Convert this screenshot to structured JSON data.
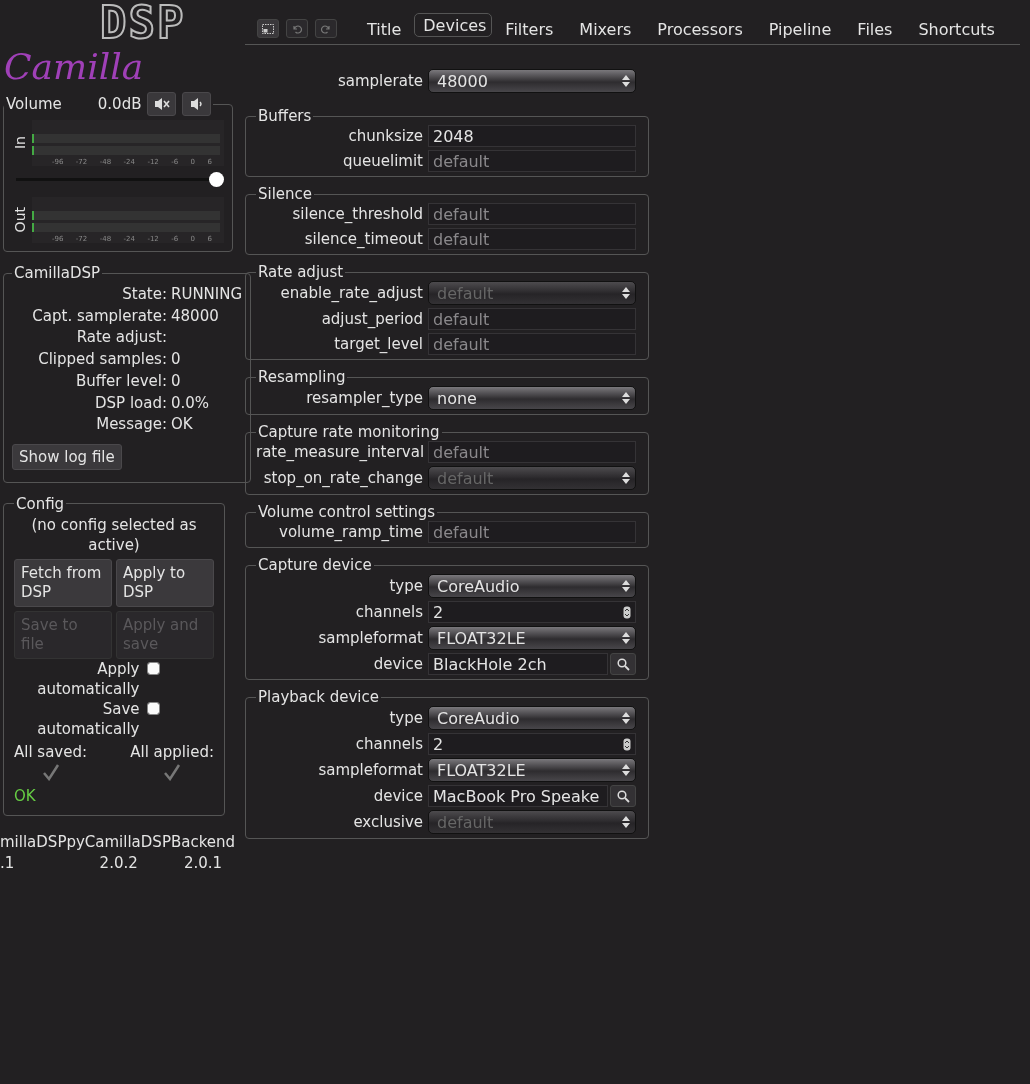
{
  "logo": {
    "script": "Camilla",
    "blocks": "DSP"
  },
  "volume": {
    "title": "Volume",
    "reading": "0.0dB",
    "level": 1,
    "meters": [
      {
        "label": "In",
        "ticks": [
          "-96",
          "-72",
          "-48",
          "-24",
          "-12",
          "-6",
          "0",
          "6"
        ]
      },
      {
        "label": "Out",
        "ticks": [
          "-96",
          "-72",
          "-48",
          "-24",
          "-12",
          "-6",
          "0",
          "6"
        ]
      }
    ]
  },
  "status": {
    "title": "CamillaDSP",
    "rows": [
      {
        "label": "State:",
        "value": "RUNNING"
      },
      {
        "label": "Capt. samplerate:",
        "value": "48000"
      },
      {
        "label": "Rate adjust:",
        "value": ""
      },
      {
        "label": "Clipped samples:",
        "value": "0"
      },
      {
        "label": "Buffer level:",
        "value": "0"
      },
      {
        "label": "DSP load:",
        "value": "0.0%"
      },
      {
        "label": "Message:",
        "value": "OK"
      }
    ],
    "button": "Show log file"
  },
  "config": {
    "title": "Config",
    "note": "(no config selected as active)",
    "buttons": [
      {
        "label": "Fetch from DSP",
        "disabled": false
      },
      {
        "label": "Apply to DSP",
        "disabled": false
      },
      {
        "label": "Save to file",
        "disabled": true
      },
      {
        "label": "Apply and save",
        "disabled": true
      }
    ],
    "checkboxes": [
      {
        "label": "Apply automatically",
        "checked": false
      },
      {
        "label": "Save automatically",
        "checked": false
      }
    ],
    "indicators": [
      {
        "label": "All saved:",
        "checked": true
      },
      {
        "label": "All applied:",
        "checked": true
      }
    ],
    "message": "OK"
  },
  "versions": [
    {
      "name": "millaDSP",
      "version": ".1"
    },
    {
      "name": "pyCamillaDSP",
      "version": "2.0.2"
    },
    {
      "name": "Backend",
      "version": "2.0.1"
    }
  ],
  "tabs": [
    {
      "label": "Title",
      "selected": false
    },
    {
      "label": "Devices",
      "selected": true
    },
    {
      "label": "Filters",
      "selected": false
    },
    {
      "label": "Mixers",
      "selected": false
    },
    {
      "label": "Processors",
      "selected": false
    },
    {
      "label": "Pipeline",
      "selected": false
    },
    {
      "label": "Files",
      "selected": false
    },
    {
      "label": "Shortcuts",
      "selected": false
    }
  ],
  "samplerate": {
    "label": "samplerate",
    "value": "48000"
  },
  "sections": [
    {
      "title": "Buffers",
      "fields": [
        {
          "label": "chunksize",
          "kind": "text",
          "value": "2048"
        },
        {
          "label": "queuelimit",
          "kind": "text",
          "placeholder": "default"
        }
      ]
    },
    {
      "title": "Silence",
      "fields": [
        {
          "label": "silence_threshold",
          "kind": "text",
          "placeholder": "default"
        },
        {
          "label": "silence_timeout",
          "kind": "text",
          "placeholder": "default"
        }
      ]
    },
    {
      "title": "Rate adjust",
      "fields": [
        {
          "label": "enable_rate_adjust",
          "kind": "select",
          "value": "default",
          "disabled": true
        },
        {
          "label": "adjust_period",
          "kind": "text",
          "placeholder": "default"
        },
        {
          "label": "target_level",
          "kind": "text",
          "placeholder": "default"
        }
      ]
    },
    {
      "title": "Resampling",
      "fields": [
        {
          "label": "resampler_type",
          "kind": "select",
          "value": "none",
          "disabled": false
        }
      ]
    },
    {
      "title": "Capture rate monitoring",
      "fields": [
        {
          "label": "rate_measure_interval",
          "kind": "text",
          "placeholder": "default"
        },
        {
          "label": "stop_on_rate_change",
          "kind": "select",
          "value": "default",
          "disabled": true
        }
      ]
    },
    {
      "title": "Volume control settings",
      "fields": [
        {
          "label": "volume_ramp_time",
          "kind": "text",
          "placeholder": "default"
        }
      ]
    },
    {
      "title": "Capture device",
      "fields": [
        {
          "label": "type",
          "kind": "select",
          "value": "CoreAudio",
          "disabled": false
        },
        {
          "label": "channels",
          "kind": "number",
          "value": "2"
        },
        {
          "label": "sampleformat",
          "kind": "select",
          "value": "FLOAT32LE",
          "disabled": false
        },
        {
          "label": "device",
          "kind": "search",
          "value": "BlackHole 2ch"
        }
      ]
    },
    {
      "title": "Playback device",
      "fields": [
        {
          "label": "type",
          "kind": "select",
          "value": "CoreAudio",
          "disabled": false
        },
        {
          "label": "channels",
          "kind": "number",
          "value": "2"
        },
        {
          "label": "sampleformat",
          "kind": "select",
          "value": "FLOAT32LE",
          "disabled": false
        },
        {
          "label": "device",
          "kind": "search",
          "value": "MacBook Pro Speake"
        },
        {
          "label": "exclusive",
          "kind": "select",
          "value": "default",
          "disabled": true
        }
      ]
    }
  ]
}
